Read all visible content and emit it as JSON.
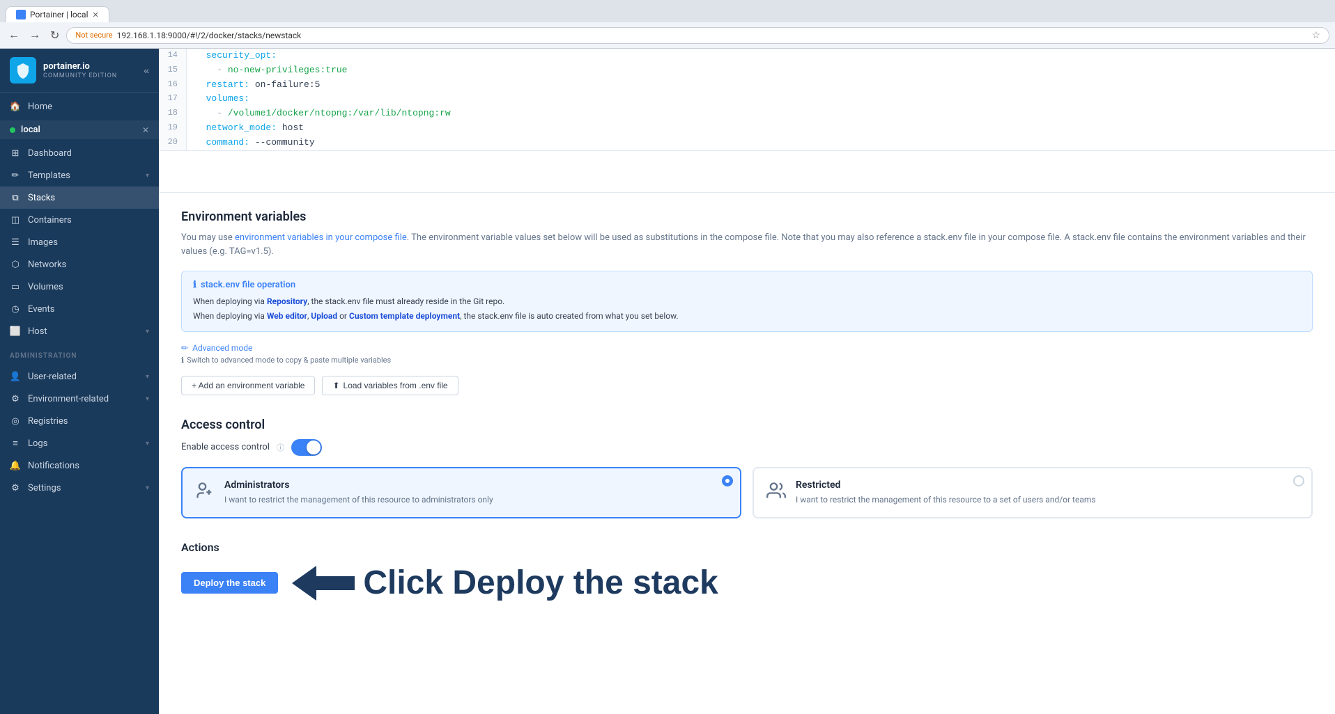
{
  "browser": {
    "tab_label": "Portainer | local",
    "url": "192.168.1.18:9000/#!/2/docker/stacks/newstack",
    "not_secure": "Not secure"
  },
  "sidebar": {
    "logo_text": "portainer.io",
    "logo_sub": "COMMUNITY EDITION",
    "env_label": "local",
    "home_label": "Home",
    "dashboard_label": "Dashboard",
    "templates_label": "Templates",
    "stacks_label": "Stacks",
    "containers_label": "Containers",
    "images_label": "Images",
    "networks_label": "Networks",
    "volumes_label": "Volumes",
    "events_label": "Events",
    "host_label": "Host",
    "administration_label": "Administration",
    "user_related_label": "User-related",
    "environment_related_label": "Environment-related",
    "registries_label": "Registries",
    "logs_label": "Logs",
    "notifications_label": "Notifications",
    "settings_label": "Settings"
  },
  "code": {
    "lines": [
      {
        "num": "14",
        "content": "  security_opt:"
      },
      {
        "num": "15",
        "content": "    - no-new-privileges:true"
      },
      {
        "num": "16",
        "content": "  restart: on-failure:5"
      },
      {
        "num": "17",
        "content": "  volumes:"
      },
      {
        "num": "18",
        "content": "    - /volume1/docker/ntopng:/var/lib/ntopng:rw"
      },
      {
        "num": "19",
        "content": "  network_mode: host"
      },
      {
        "num": "20",
        "content": "  command: --community"
      }
    ]
  },
  "env_variables": {
    "title": "Environment variables",
    "desc_prefix": "You may use ",
    "desc_link": "environment variables in your compose file",
    "desc_suffix": ". The environment variable values set below will be used as substitutions in the compose file. Note that you may also reference a stack.env file in your compose file. A stack.env file contains the environment variables and their values (e.g. TAG=v1.5).",
    "info_title": "stack.env file operation",
    "info_line1_prefix": "When deploying via ",
    "info_line1_bold": "Repository",
    "info_line1_suffix": ", the stack.env file must already reside in the Git repo.",
    "info_line2_prefix": "When deploying via ",
    "info_line2_bold1": "Web editor",
    "info_line2_sep1": ", ",
    "info_line2_bold2": "Upload",
    "info_line2_sep2": " or ",
    "info_line2_bold3": "Custom template deployment",
    "info_line2_suffix": ", the stack.env file is auto created from what you set below.",
    "advanced_mode_label": "Advanced mode",
    "advanced_hint": "Switch to advanced mode to copy & paste multiple variables",
    "add_var_label": "+ Add an environment variable",
    "load_vars_label": "Load variables from .env file"
  },
  "access_control": {
    "title": "Access control",
    "enable_label": "Enable access control",
    "admin_title": "Administrators",
    "admin_desc": "I want to restrict the management of this resource to administrators only",
    "restricted_title": "Restricted",
    "restricted_desc": "I want to restrict the management of this resource to a set of users and/or teams"
  },
  "actions": {
    "title": "Actions",
    "deploy_label": "Deploy the stack",
    "click_annotation": "Click Deploy the stack"
  }
}
